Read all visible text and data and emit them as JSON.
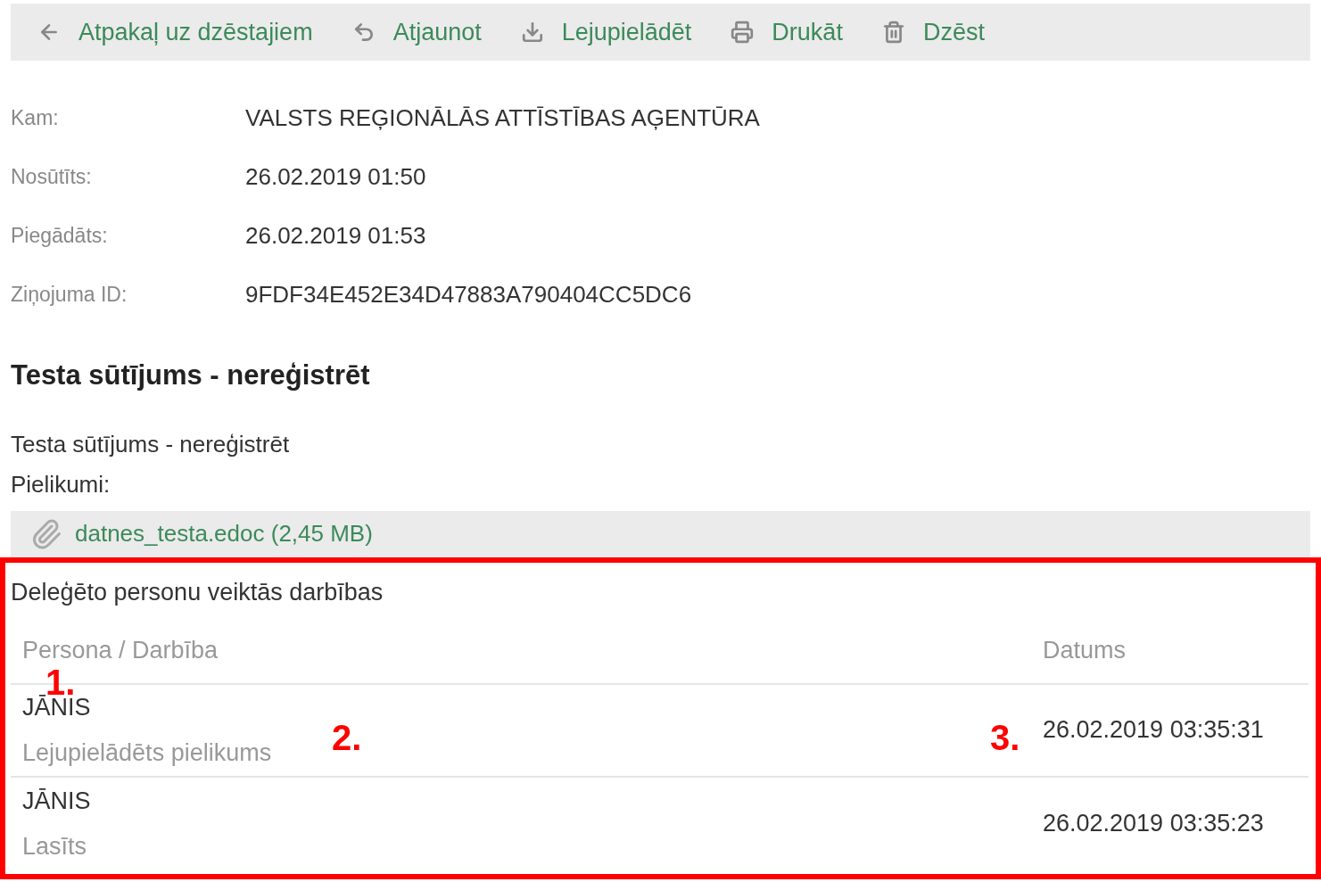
{
  "toolbar": [
    {
      "kind": "back",
      "label": "Atpakaļ uz dzēstajiem"
    },
    {
      "kind": "restore",
      "label": "Atjaunot"
    },
    {
      "kind": "download",
      "label": "Lejupielādēt"
    },
    {
      "kind": "print",
      "label": "Drukāt"
    },
    {
      "kind": "delete",
      "label": "Dzēst"
    }
  ],
  "fields": [
    {
      "label": "Kam:",
      "value": "VALSTS REĢIONĀLĀS ATTĪSTĪBAS AĢENTŪRA"
    },
    {
      "label": "Nosūtīts:",
      "value": "26.02.2019 01:50"
    },
    {
      "label": "Piegādāts:",
      "value": "26.02.2019 01:53"
    },
    {
      "label": "Ziņojuma ID:",
      "value": "9FDF34E452E34D47883A790404CC5DC6"
    }
  ],
  "subject": "Testa sūtījums - nereģistrēt",
  "body": "Testa sūtījums - nereģistrēt",
  "attachments_label": "Pielikumi:",
  "attachment": "datnes_testa.edoc (2,45 MB)",
  "delegated": {
    "title": "Deleģēto personu veiktās darbības",
    "columns": [
      "Persona / Darbība",
      "Datums"
    ],
    "rows": [
      {
        "person": "JĀNIS",
        "action": "Lejupielādēts pielikums",
        "date": "26.02.2019 03:35:31"
      },
      {
        "person": "JĀNIS",
        "action": "Lasīts",
        "date": "26.02.2019 03:35:23"
      }
    ]
  },
  "annotations": [
    "1.",
    "2.",
    "3."
  ]
}
